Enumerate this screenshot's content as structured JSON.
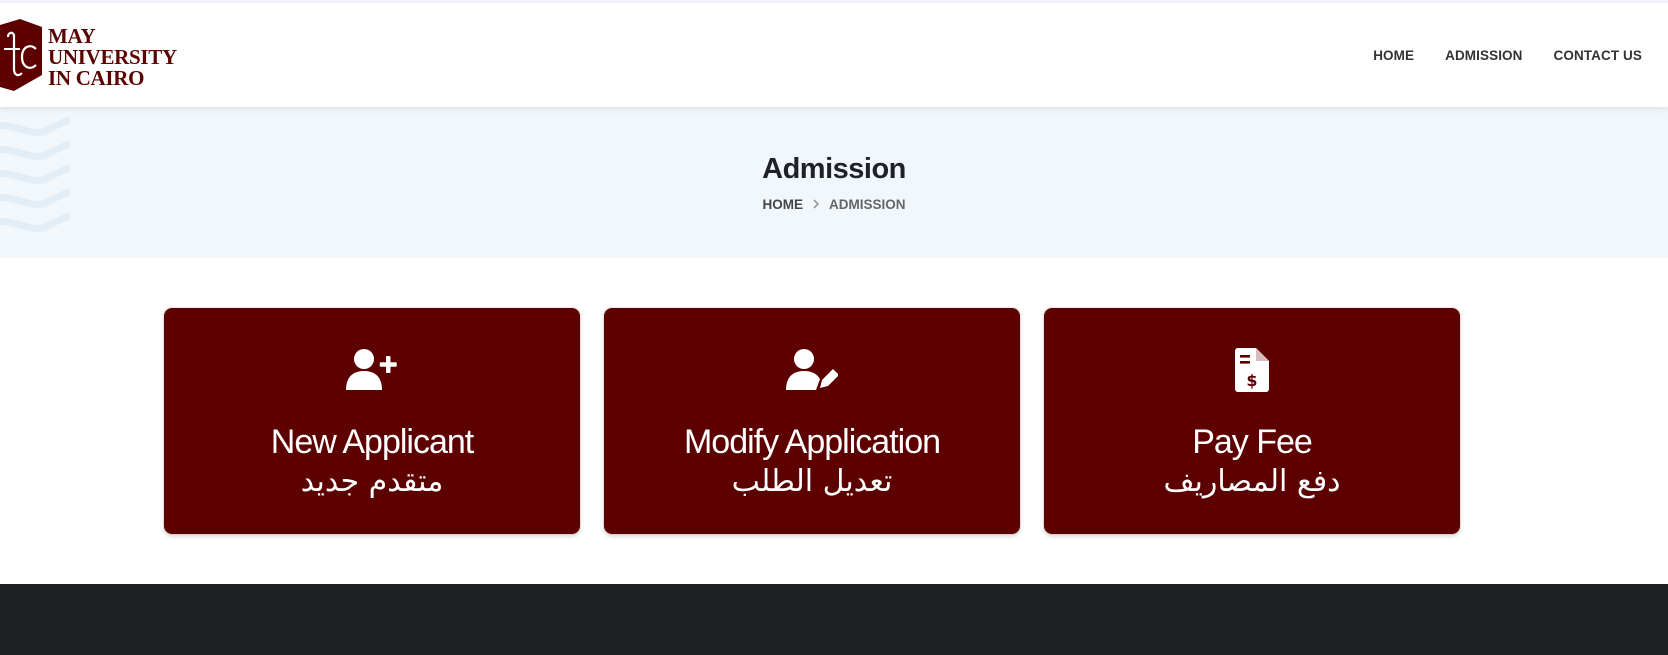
{
  "header": {
    "logo": {
      "line1": "MAY",
      "line2": "UNIVERSITY",
      "line3": "IN CAIRO"
    },
    "nav": [
      {
        "label": "HOME"
      },
      {
        "label": "ADMISSION"
      },
      {
        "label": "CONTACT US"
      }
    ]
  },
  "banner": {
    "title": "Admission",
    "breadcrumb": {
      "home": "HOME",
      "separator_icon": "chevron-right-icon",
      "current": "ADMISSION"
    }
  },
  "cards": [
    {
      "icon": "user-plus-icon",
      "title": "New Applicant",
      "subtitle": "متقدم جديد"
    },
    {
      "icon": "user-edit-icon",
      "title": "Modify Application",
      "subtitle": "تعديل الطلب"
    },
    {
      "icon": "invoice-dollar-icon",
      "title": "Pay Fee",
      "subtitle": "دفع المصاريف"
    }
  ],
  "colors": {
    "brand": "#5c0000",
    "banner_bg": "#f2f7fb",
    "footer_bg": "#1e2124",
    "nav_text": "#333333"
  }
}
